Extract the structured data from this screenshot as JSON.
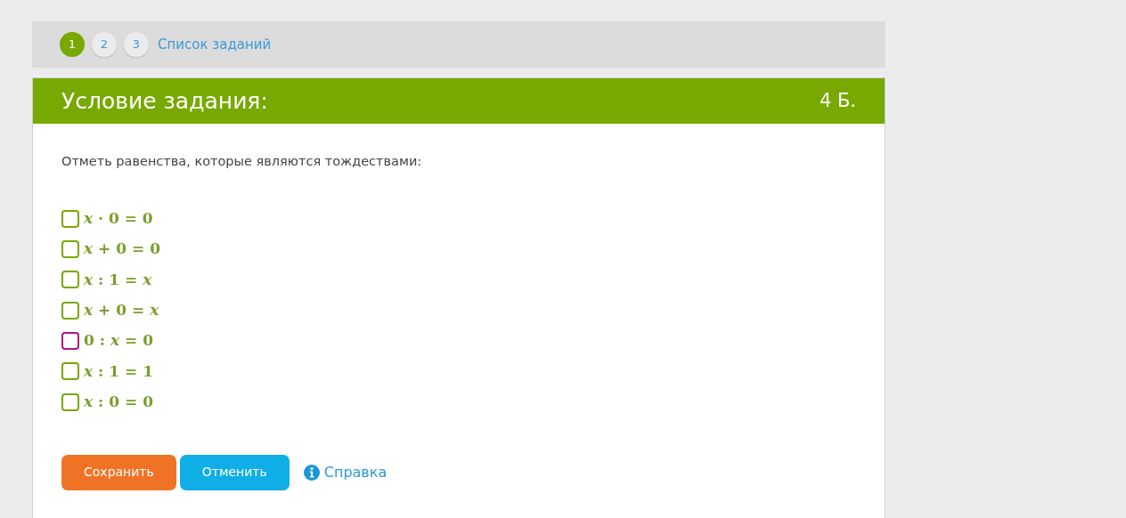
{
  "steps": [
    {
      "label": "1",
      "selected": true
    },
    {
      "label": "2",
      "selected": false
    },
    {
      "label": "3",
      "selected": false
    }
  ],
  "task_list_link": "Список заданий",
  "header": {
    "title": "Условие задания:",
    "points": "4 Б."
  },
  "question": "Отметь равенства, которые являются тождествами:",
  "options": [
    {
      "formula": "*x* · 0 = 0",
      "checked": false,
      "color": "#79a800"
    },
    {
      "formula": "*x* + 0 = 0",
      "checked": false,
      "color": "#79a800"
    },
    {
      "formula": "*x* : 1 = *x*",
      "checked": false,
      "color": "#79a800"
    },
    {
      "formula": "*x* + 0 = *x*",
      "checked": false,
      "color": "#79a800"
    },
    {
      "formula": "0 : *x* = 0",
      "checked": false,
      "color": "#b5147e"
    },
    {
      "formula": "*x* : 1 = 1",
      "checked": false,
      "color": "#79a800"
    },
    {
      "formula": "*x* : 0 = 0",
      "checked": false,
      "color": "#79a800"
    }
  ],
  "buttons": [
    {
      "label": "Сохранить",
      "kind": "save"
    },
    {
      "label": "Отменить",
      "kind": "cancel"
    }
  ],
  "help_link": "Справка"
}
